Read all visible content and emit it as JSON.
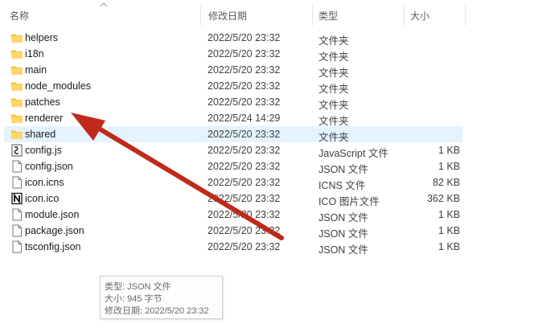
{
  "columns": {
    "name": "名称",
    "modified": "修改日期",
    "type": "类型",
    "size": "大小"
  },
  "files": [
    {
      "name": "helpers",
      "modified": "2022/5/20 23:32",
      "type": "文件夹",
      "size": "",
      "icon": "folder-icon"
    },
    {
      "name": "i18n",
      "modified": "2022/5/20 23:32",
      "type": "文件夹",
      "size": "",
      "icon": "folder-icon"
    },
    {
      "name": "main",
      "modified": "2022/5/20 23:32",
      "type": "文件夹",
      "size": "",
      "icon": "folder-icon"
    },
    {
      "name": "node_modules",
      "modified": "2022/5/20 23:32",
      "type": "文件夹",
      "size": "",
      "icon": "folder-icon"
    },
    {
      "name": "patches",
      "modified": "2022/5/20 23:32",
      "type": "文件夹",
      "size": "",
      "icon": "folder-icon"
    },
    {
      "name": "renderer",
      "modified": "2022/5/24 14:29",
      "type": "文件夹",
      "size": "",
      "icon": "folder-icon"
    },
    {
      "name": "shared",
      "modified": "2022/5/20 23:32",
      "type": "文件夹",
      "size": "",
      "icon": "folder-icon"
    },
    {
      "name": "config.js",
      "modified": "2022/5/20 23:32",
      "type": "JavaScript 文件",
      "size": "1 KB",
      "icon": "javascript-file-icon"
    },
    {
      "name": "config.json",
      "modified": "2022/5/20 23:32",
      "type": "JSON 文件",
      "size": "1 KB",
      "icon": "file-icon"
    },
    {
      "name": "icon.icns",
      "modified": "2022/5/20 23:32",
      "type": "ICNS 文件",
      "size": "82 KB",
      "icon": "file-icon"
    },
    {
      "name": "icon.ico",
      "modified": "2022/5/20 23:32",
      "type": "ICO 图片文件",
      "size": "362 KB",
      "icon": "ico-file-icon"
    },
    {
      "name": "module.json",
      "modified": "2022/5/20 23:32",
      "type": "JSON 文件",
      "size": "1 KB",
      "icon": "file-icon"
    },
    {
      "name": "package.json",
      "modified": "2022/5/20 23:32",
      "type": "JSON 文件",
      "size": "1 KB",
      "icon": "file-icon"
    },
    {
      "name": "tsconfig.json",
      "modified": "2022/5/20 23:32",
      "type": "JSON 文件",
      "size": "1 KB",
      "icon": "file-icon"
    }
  ],
  "selected_index": 6,
  "tooltip": {
    "type_line": "类型: JSON 文件",
    "size_line": "大小: 945 字节",
    "modified_line": "修改日期: 2022/5/20 23:32"
  },
  "colors": {
    "selection": "#e5f3ff",
    "folder": "#f5c242",
    "arrow": "#c0291c"
  }
}
